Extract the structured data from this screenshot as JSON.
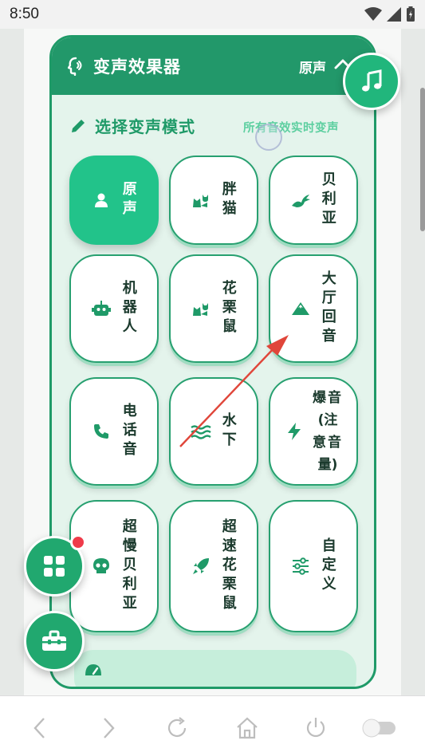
{
  "status": {
    "time": "8:50"
  },
  "header": {
    "title": "变声效果器",
    "current_mode": "原声"
  },
  "section": {
    "title": "选择变声模式",
    "hint": "所有音效实时变声"
  },
  "modes": [
    {
      "label": "原声",
      "icon": "user-icon",
      "active": true
    },
    {
      "label": "胖猫",
      "icon": "cat-icon",
      "active": false
    },
    {
      "label": "贝利亚",
      "icon": "dragon-icon",
      "active": false
    },
    {
      "label": "机器人",
      "icon": "robot-icon",
      "active": false
    },
    {
      "label": "花栗鼠",
      "icon": "cat-icon",
      "active": false
    },
    {
      "label": "大厅回音",
      "icon": "mountain-icon",
      "active": false
    },
    {
      "label": "电话音",
      "icon": "phone-icon",
      "active": false
    },
    {
      "label": "水下",
      "icon": "water-icon",
      "active": false
    },
    {
      "label": "爆音(注意音量)",
      "icon": "bolt-icon",
      "active": false
    },
    {
      "label": "超慢贝利亚",
      "icon": "skull-icon",
      "active": false
    },
    {
      "label": "超速花栗鼠",
      "icon": "rocket-icon",
      "active": false
    },
    {
      "label": "自定义",
      "icon": "sliders-icon",
      "active": false
    }
  ],
  "colors": {
    "primary": "#22986a",
    "accent": "#22c38a",
    "panel_bg": "#e4f4ec",
    "badge": "#ef3b4a"
  }
}
